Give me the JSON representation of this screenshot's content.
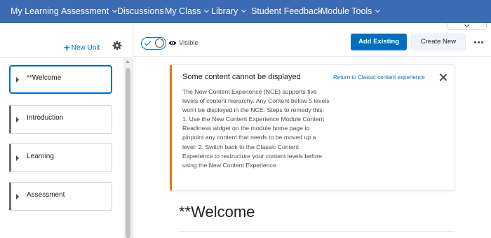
{
  "nav": {
    "items": [
      {
        "label": "My Learning",
        "dropdown": false
      },
      {
        "label": "Assessment",
        "dropdown": true
      },
      {
        "label": "Discussions",
        "dropdown": false
      },
      {
        "label": "My Class",
        "dropdown": true
      },
      {
        "label": "Library",
        "dropdown": true
      },
      {
        "label": "Student Feedback",
        "dropdown": false
      },
      {
        "label": "Module Tools",
        "dropdown": true
      }
    ],
    "background": "#3a6bb3"
  },
  "sidebar": {
    "new_unit_plus": "+",
    "new_unit_label": "New Unit",
    "units": [
      {
        "label": "**Welcome",
        "selected": true
      },
      {
        "label": "Introduction",
        "selected": false
      },
      {
        "label": "Learning",
        "selected": false
      },
      {
        "label": "Assessment",
        "selected": false
      }
    ]
  },
  "toolbar": {
    "visibility_label": "Visible",
    "visibility_on": true,
    "add_existing_label": "Add Existing",
    "create_new_label": "Create New"
  },
  "alert": {
    "title": "Some content cannot be displayed",
    "link_label": "Return to Classic content experience",
    "body": "The New Content Experience (NCE) supports five levels of content hierarchy. Any Content below 5 levels won't be displayed in the NCE. Steps to remedy this: 1. Use the New Content Experience Module Content Readiness widget on the module home page to pinpoint any content that needs to be moved up a level. 2. Switch back to the Classic Content Experience to restructure your content levels before using the New Content Experience.",
    "accent": "#e87511"
  },
  "content": {
    "title": "**Welcome"
  },
  "colors": {
    "primary": "#006fbf",
    "text": "#202122",
    "muted": "#494c4e"
  }
}
